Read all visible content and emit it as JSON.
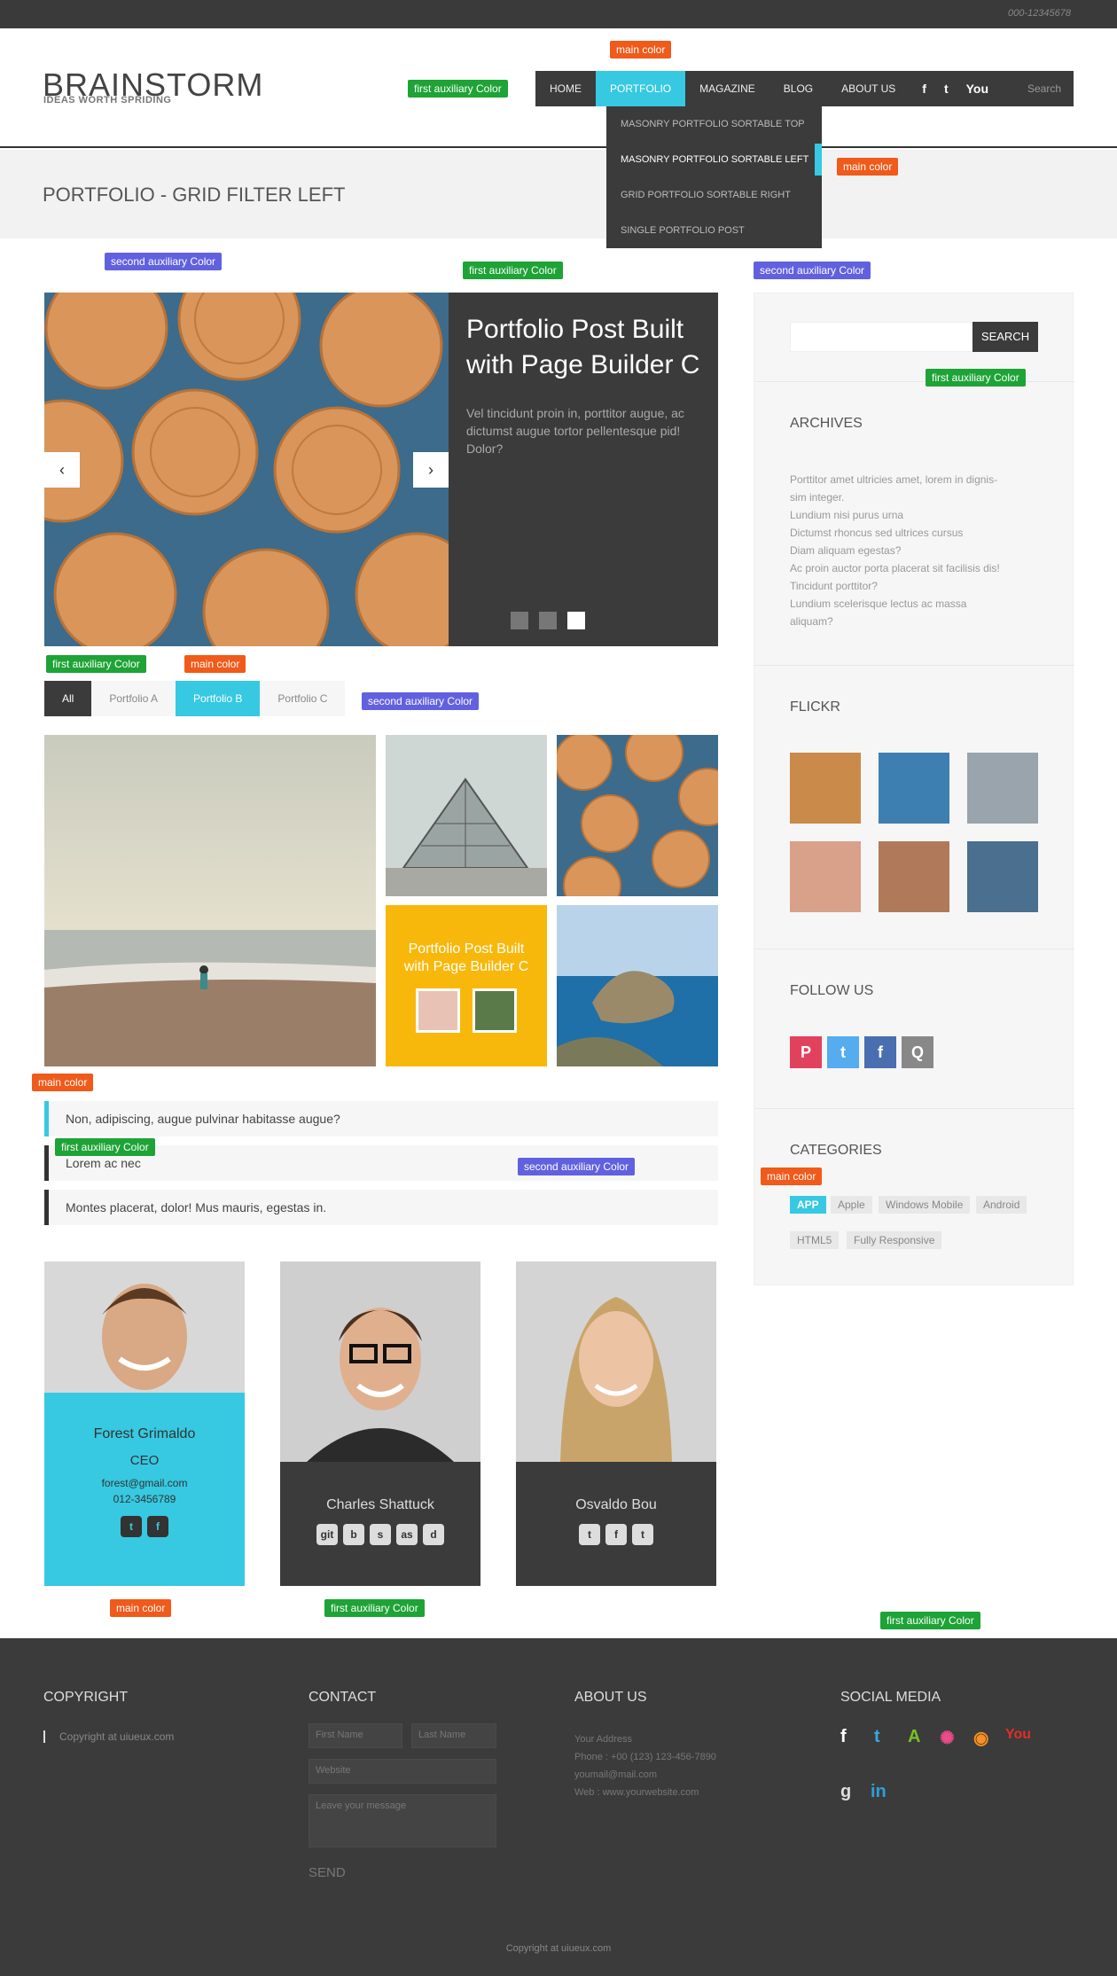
{
  "topbar": {
    "phone": "000-12345678"
  },
  "header": {
    "logo": "BRAINSTORM",
    "tagline": "IDEAS WORTH SPRIDING"
  },
  "nav": {
    "items": [
      "HOME",
      "PORTFOLIO",
      "MAGAZINE",
      "BLOG",
      "ABOUT US"
    ],
    "social": [
      "f",
      "t",
      "You"
    ],
    "search": "Search"
  },
  "dropdown": [
    "MASONRY PORTFOLIO SORTABLE TOP",
    "MASONRY PORTFOLIO SORTABLE LEFT",
    "GRID PORTFOLIO SORTABLE RIGHT",
    "SINGLE PORTFOLIO POST"
  ],
  "page": {
    "title": "PORTFOLIO - GRID FILTER LEFT"
  },
  "labels": {
    "main": "main color",
    "first": "first auxiliary Color",
    "second": "second auxiliary Color"
  },
  "slider": {
    "title": "Portfolio Post Built with Page Builder C",
    "text": "Vel tincidunt proin in, porttitor augue, ac dictumst augue tortor pellentesque pid! Dolor?",
    "prev": "‹",
    "next": "›"
  },
  "filters": [
    "All",
    "Portfolio A",
    "Portfolio B",
    "Portfolio C"
  ],
  "yellow": {
    "title": "Portfolio Post Built with Page Builder C"
  },
  "accordion": [
    "Non, adipiscing, augue pulvinar habitasse augue?",
    "Lorem ac nec",
    "Montes placerat, dolor! Mus mauris, egestas in."
  ],
  "team": [
    {
      "name": "Forest Grimaldo",
      "role": "CEO",
      "email": "forest@gmail.com",
      "phone": "012-3456789",
      "icons": [
        "t",
        "f"
      ]
    },
    {
      "name": "Charles Shattuck",
      "icons": [
        "git",
        "b",
        "s",
        "as",
        "d"
      ]
    },
    {
      "name": "Osvaldo Bou",
      "icons": [
        "t",
        "f",
        "t"
      ]
    }
  ],
  "sidebar": {
    "search_btn": "SEARCH",
    "archives_title": "ARCHIVES",
    "archives": [
      "Porttitor amet ultricies amet, lorem in dignis-",
      "sim integer.",
      "Lundium nisi purus urna",
      "Dictumst rhoncus sed ultrices cursus",
      "Diam aliquam egestas?",
      "Ac proin auctor porta placerat sit facilisis dis!",
      "Tincidunt porttitor?",
      "Lundium scelerisque lectus ac massa",
      "aliquam?"
    ],
    "flickr_title": "FLICKR",
    "follow_title": "FOLLOW US",
    "follow": [
      "P",
      "t",
      "f",
      "Q"
    ],
    "categories_title": "CATEGORIES",
    "categories": [
      "APP",
      "Apple",
      "Windows Mobile",
      "Android",
      "HTML5",
      "Fully Responsive"
    ]
  },
  "footer": {
    "copyright_title": "COPYRIGHT",
    "copyright_text": "Copyright at uiueux.com",
    "contact_title": "CONTACT",
    "first_name": "First Name",
    "last_name": "Last Name",
    "website": "Website",
    "message": "Leave your message",
    "send": "SEND",
    "about_title": "ABOUT US",
    "about": [
      "Your Address",
      "Phone : +00 (123) 123-456-7890",
      "youmail@mail.com",
      "Web : www.yourwebsite.com"
    ],
    "social_title": "SOCIAL MEDIA",
    "social": [
      "f",
      "t",
      "A",
      "✺",
      "◉",
      "You",
      "g",
      "in"
    ],
    "bottom": "Copyright at uiueux.com"
  }
}
